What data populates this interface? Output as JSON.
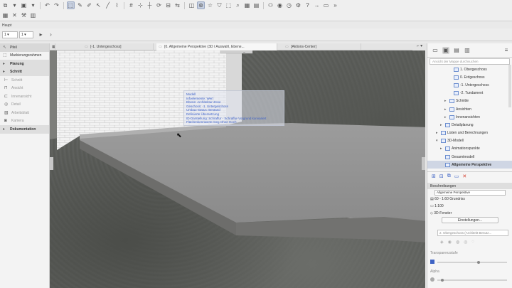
{
  "toolbar": {
    "row1_icons": [
      "layer-icon",
      "dropdown-icon",
      "save-icon",
      "dropdown-icon",
      "undo-icon",
      "redo-icon",
      "select-icon",
      "pencil-icon",
      "eyedropper-icon",
      "arrow-tool-icon",
      "line-tool-icon",
      "polyline-tool-icon",
      "grid-icon",
      "snap-icon",
      "guide-icon",
      "rotate-icon",
      "align-icon",
      "mirror-icon",
      "cube-view-icon",
      "orbit-icon",
      "star-icon",
      "shield-icon",
      "marquee-icon",
      "find-icon",
      "grid-view-icon",
      "layout-icon",
      "teamwork-icon",
      "view-icon",
      "clock-icon",
      "settings-icon",
      "help-icon",
      "arrow-right-icon",
      "window-icon",
      "more-icon"
    ],
    "row2_icons": [
      "grid-small-icon",
      "x-icon",
      "tools-icon",
      "panel-icon"
    ]
  },
  "info": {
    "label": "Haupt",
    "pen_value": "1",
    "scale_value": "1"
  },
  "left_panel": {
    "items": [
      {
        "label": "Pfeil",
        "type": "active",
        "icon": "arrow-icon"
      },
      {
        "label": "Markierungsrahmen",
        "type": "normal",
        "icon": "marquee-icon"
      },
      {
        "label": "Planung",
        "type": "group",
        "icon": "triangle-right-icon"
      },
      {
        "label": "Schnitt",
        "type": "group",
        "icon": "triangle-right-icon"
      },
      {
        "label": "Schnitt",
        "type": "dim",
        "icon": "section-icon"
      },
      {
        "label": "Ansicht",
        "type": "dim",
        "icon": "elevation-icon"
      },
      {
        "label": "Innenansicht",
        "type": "dim",
        "icon": "interior-icon"
      },
      {
        "label": "Detail",
        "type": "dim",
        "icon": "detail-icon"
      },
      {
        "label": "Arbeitsblatt",
        "type": "dim",
        "icon": "worksheet-icon"
      },
      {
        "label": "Kamera",
        "type": "dim",
        "icon": "camera-icon"
      },
      {
        "label": "Dokumentation",
        "type": "group",
        "icon": "triangle-right-icon"
      }
    ]
  },
  "tabs": [
    {
      "label": "[-1. Untergeschoss]",
      "active": false
    },
    {
      "label": "[0. Allgemeine Perspektive (3D / Auswahl, Ebene...",
      "active": true
    },
    {
      "label": "[Aktions-Center]",
      "active": false
    }
  ],
  "tooltip": {
    "lines": [
      "Modell",
      "Infoelemente: Wert",
      "Ebene: Architektur-Zone",
      "Geschoss: -1. Untergeschoss",
      "Umbau-Status: Bestand",
      "Definierte Übersetzung",
      "ID-Darstellung: Schraffur - Schraffur-Vorgrund konvariert",
      "Flächenkennwerte Geg Ohne Hoch"
    ]
  },
  "right_panel": {
    "search_placeholder": "Ansicht der Mappe durchsuchen",
    "tree": [
      {
        "label": "1. Obergeschoss",
        "indent": 5,
        "arrow": "",
        "active": false
      },
      {
        "label": "0. Erdgeschoss",
        "indent": 5,
        "arrow": "",
        "active": false
      },
      {
        "label": "-1. Untergeschoss",
        "indent": 5,
        "arrow": "",
        "active": false
      },
      {
        "label": "-2. Tundament",
        "indent": 5,
        "arrow": "",
        "active": false
      },
      {
        "label": "Schnitte",
        "indent": 4,
        "arrow": "▸",
        "active": false
      },
      {
        "label": "Ansichten",
        "indent": 4,
        "arrow": "▸",
        "active": false
      },
      {
        "label": "Innenansichten",
        "indent": 4,
        "arrow": "▸",
        "active": false
      },
      {
        "label": "Detailplanung",
        "indent": 3,
        "arrow": "▸",
        "active": false
      },
      {
        "label": "Listen und Berechnungen",
        "indent": 2,
        "arrow": "▸",
        "active": false
      },
      {
        "label": "3D-Modell",
        "indent": 2,
        "arrow": "▾",
        "active": false
      },
      {
        "label": "Animationspunkte",
        "indent": 3,
        "arrow": "▸",
        "active": false
      },
      {
        "label": "Gesamtmodell",
        "indent": 3,
        "arrow": "",
        "active": false
      },
      {
        "label": "Allgemeine Perspektive",
        "indent": 3,
        "arrow": "",
        "active": true
      }
    ],
    "descriptions_header": "Beschreibungen",
    "view_name": "Allgemeine Perspektive",
    "row_plan": "60 - 1:60 Grundriss",
    "row_scale": "1:100",
    "row_3d": "3D-Fenster",
    "settings_button": "Einstellungen...",
    "layer_select": "2. Obergeschoss (Architekt Benutz...",
    "transparency_label": "Transparenzstufe",
    "transparency_value": 0.6,
    "alpha_label": "Alpha",
    "alpha_value": 0.05
  }
}
